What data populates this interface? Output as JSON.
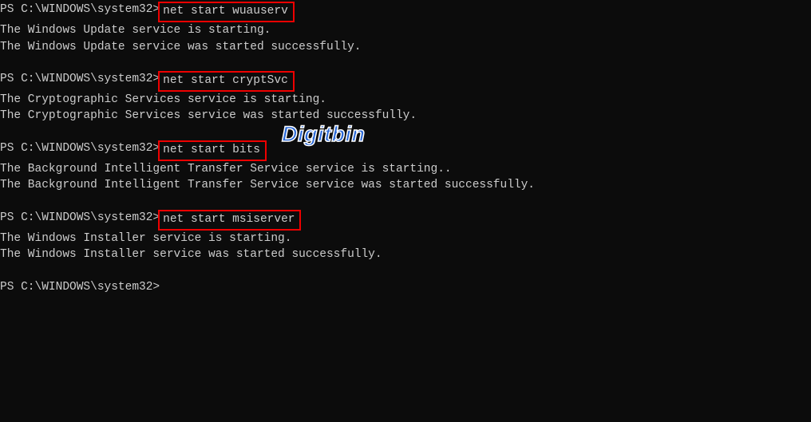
{
  "prompt": "PS C:\\WINDOWS\\system32> ",
  "watermark": "Digitbin",
  "blocks": [
    {
      "command": "net start wuauserv",
      "out1": "The Windows Update service is starting.",
      "out2": "The Windows Update service was started successfully."
    },
    {
      "command": "net start cryptSvc",
      "out1": "The Cryptographic Services service is starting.",
      "out2": "The Cryptographic Services service was started successfully."
    },
    {
      "command": "net start bits",
      "out1": "The Background Intelligent Transfer Service service is starting..",
      "out2": "The Background Intelligent Transfer Service service was started successfully."
    },
    {
      "command": "net start msiserver",
      "out1": "The Windows Installer service is starting.",
      "out2": "The Windows Installer service was started successfully."
    }
  ]
}
